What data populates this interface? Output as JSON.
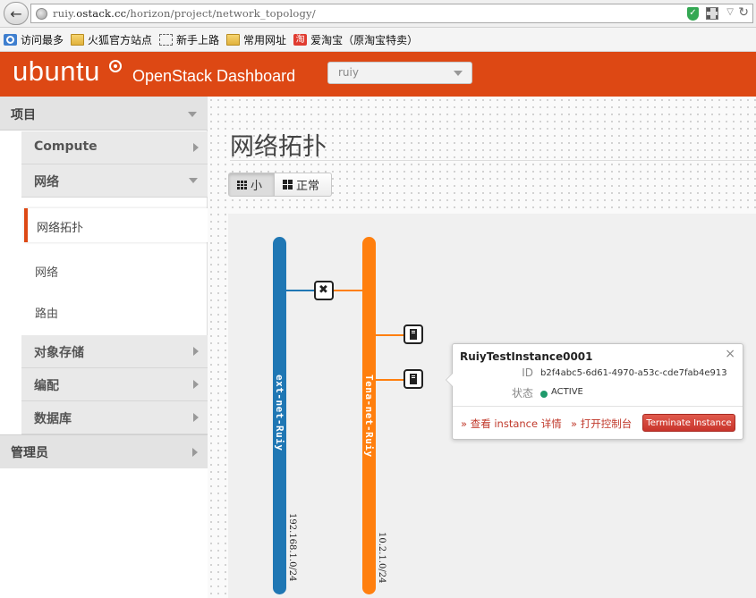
{
  "browser": {
    "url_prefix": "ruiy.",
    "url_host": "ostack.cc",
    "url_path": "/horizon/project/network_topology/",
    "bookmarks": [
      "访问最多",
      "火狐官方站点",
      "新手上路",
      "常用网址",
      "爱淘宝（原淘宝特卖）"
    ],
    "taobao_glyph": "淘"
  },
  "header": {
    "logo_text": "ubuntu",
    "app_title": "OpenStack Dashboard",
    "project": "ruiy"
  },
  "sidebar": {
    "project_panel": "项目",
    "compute": "Compute",
    "network": "网络",
    "network_items": [
      "网络拓扑",
      "网络",
      "路由"
    ],
    "object_store": "对象存储",
    "orchestration": "编配",
    "database": "数据库",
    "admin_panel": "管理员"
  },
  "main": {
    "title": "网络拓扑",
    "view_small": "小",
    "view_normal": "正常"
  },
  "topology": {
    "networks": [
      {
        "name": "ext-net-Ruiy",
        "cidr": "192.168.1.0/24",
        "color": "#1f77b4"
      },
      {
        "name": "Tena-net-Ruiy",
        "cidr": "10.2.1.0/24",
        "color": "#ff7f0e"
      }
    ],
    "popup": {
      "instance_name": "RuiyTestInstance0001",
      "id_label": "ID",
      "id_value": "b2f4abc5-6d61-4970-a53c-cde7fab4e913",
      "status_label": "状态",
      "status_value": "ACTIVE",
      "view_details": "» 查看 instance 详情",
      "open_console": "» 打开控制台",
      "terminate": "Terminate Instance",
      "close": "×"
    }
  },
  "colors": {
    "brand": "#dd4814",
    "status_active": "#1e9a6b",
    "danger": "#c9342b"
  }
}
